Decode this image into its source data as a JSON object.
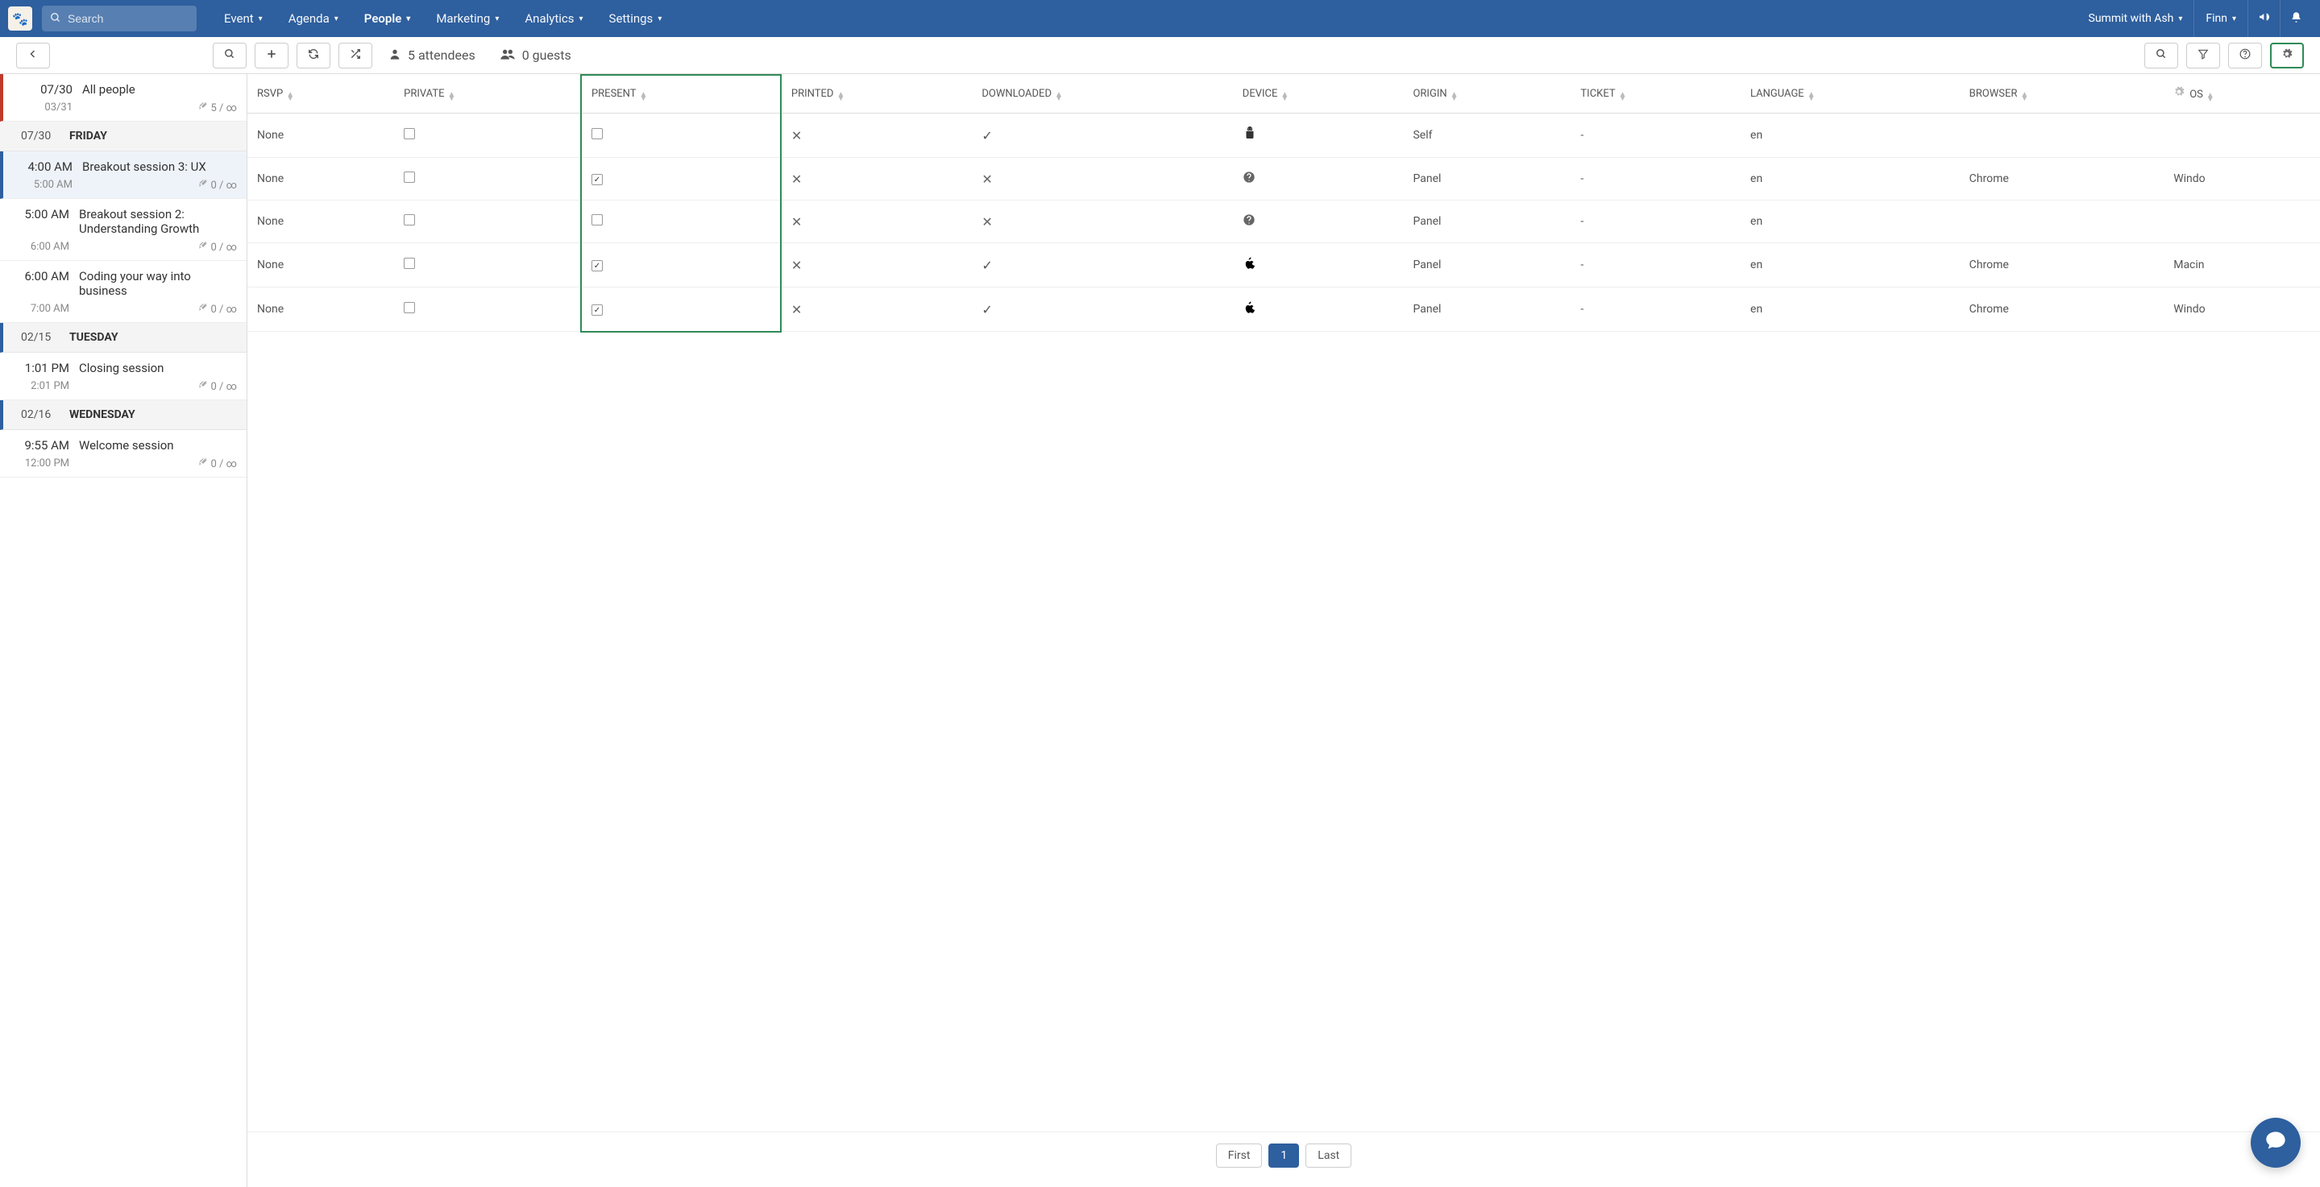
{
  "nav": {
    "search_placeholder": "Search",
    "menu": [
      "Event",
      "Agenda",
      "People",
      "Marketing",
      "Analytics",
      "Settings"
    ],
    "active_menu": "People",
    "event_name": "Summit with Ash",
    "user_name": "Finn"
  },
  "toolbar": {
    "attendees_count": "5 attendees",
    "guests_count": "0 guests"
  },
  "sidebar": [
    {
      "type": "session",
      "bar": "red",
      "time1": "07/30",
      "time2": "03/31",
      "title": "All people",
      "tag_count": "5",
      "tag_cap": "∞"
    },
    {
      "type": "header",
      "bar": "none",
      "date": "07/30",
      "label": "FRIDAY"
    },
    {
      "type": "session",
      "bar": "selected",
      "time1": "4:00 AM",
      "time2": "5:00 AM",
      "title": "Breakout session 3: UX",
      "tag_count": "0",
      "tag_cap": "∞"
    },
    {
      "type": "session",
      "bar": "none",
      "time1": "5:00 AM",
      "time2": "6:00 AM",
      "title": "Breakout session 2: Understanding Growth",
      "tag_count": "0",
      "tag_cap": "∞"
    },
    {
      "type": "session",
      "bar": "none",
      "time1": "6:00 AM",
      "time2": "7:00 AM",
      "title": "Coding your way into business",
      "tag_count": "0",
      "tag_cap": "∞"
    },
    {
      "type": "header",
      "bar": "blue",
      "date": "02/15",
      "label": "TUESDAY"
    },
    {
      "type": "session",
      "bar": "none",
      "time1": "1:01 PM",
      "time2": "2:01 PM",
      "title": "Closing session",
      "tag_count": "0",
      "tag_cap": "∞"
    },
    {
      "type": "header",
      "bar": "blue",
      "date": "02/16",
      "label": "WEDNESDAY"
    },
    {
      "type": "session",
      "bar": "none",
      "time1": "9:55 AM",
      "time2": "12:00 PM",
      "title": "Welcome session",
      "tag_count": "0",
      "tag_cap": "∞"
    }
  ],
  "table": {
    "columns": [
      "RSVP",
      "PRIVATE",
      "PRESENT",
      "PRINTED",
      "DOWNLOADED",
      "DEVICE",
      "ORIGIN",
      "TICKET",
      "LANGUAGE",
      "BROWSER",
      "OS"
    ],
    "highlight_col": "PRESENT",
    "rows": [
      {
        "rsvp": "None",
        "private": false,
        "present": false,
        "printed": "x",
        "downloaded": "check",
        "device": "android",
        "origin": "Self",
        "ticket": "-",
        "language": "en",
        "browser": "",
        "os": ""
      },
      {
        "rsvp": "None",
        "private": false,
        "present": true,
        "printed": "x",
        "downloaded": "x",
        "device": "question",
        "origin": "Panel",
        "ticket": "-",
        "language": "en",
        "browser": "Chrome",
        "os": "Windo"
      },
      {
        "rsvp": "None",
        "private": false,
        "present": false,
        "printed": "x",
        "downloaded": "x",
        "device": "question",
        "origin": "Panel",
        "ticket": "-",
        "language": "en",
        "browser": "",
        "os": ""
      },
      {
        "rsvp": "None",
        "private": false,
        "present": true,
        "printed": "x",
        "downloaded": "check",
        "device": "apple",
        "origin": "Panel",
        "ticket": "-",
        "language": "en",
        "browser": "Chrome",
        "os": "Macin"
      },
      {
        "rsvp": "None",
        "private": false,
        "present": true,
        "printed": "x",
        "downloaded": "check",
        "device": "apple",
        "origin": "Panel",
        "ticket": "-",
        "language": "en",
        "browser": "Chrome",
        "os": "Windo"
      }
    ]
  },
  "pagination": {
    "first": "First",
    "page": "1",
    "last": "Last"
  }
}
